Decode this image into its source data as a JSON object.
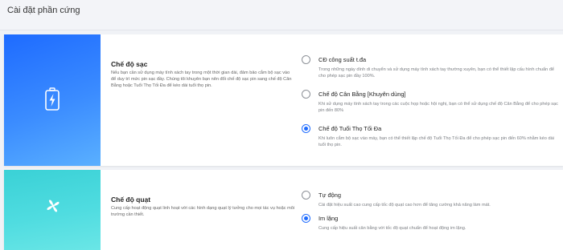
{
  "header": {
    "title": "Cài đặt phần cứng"
  },
  "charge": {
    "icon": "battery-charging-icon",
    "title": "Chế độ sạc",
    "description": "Nếu bạn cần sử dụng máy tính xách tay trong một thời gian dài, đảm bảo cắm bộ sạc vào để duy trì mức pin sạc đầy. Chúng tôi khuyên bạn nên đổi chế độ sạc pin sang chế độ Cân Bằng hoặc Tuổi Thọ Tối Đa để kéo dài tuổi thọ pin.",
    "options": [
      {
        "label": "CĐ công suất t.đa",
        "desc": "Trong những ngày dính di chuyển và sử dụng máy tính xách tay thường xuyên, bạn có thể thiết lập cấu hình chuẩn để cho phép sạc pin đầy 100%.",
        "selected": false
      },
      {
        "label": "Chế độ Cân Bằng [Khuyên dùng]",
        "desc": "Khi sử dụng máy tính xách tay trong các cuộc họp hoặc hội nghị, bạn có thể sử dụng chế độ Cân Bằng để cho phép sạc pin đến 80%",
        "selected": false
      },
      {
        "label": "Chế độ Tuổi Thọ Tối Đa",
        "desc": "Khi luôn cắm bộ sạc vào máy, bạn có thể thiết lập chế độ Tuổi Thọ Tối Đa để cho phép sạc pin đến 60% nhằm kéo dài tuổi thọ pin.",
        "selected": true
      }
    ]
  },
  "fan": {
    "icon": "fan-icon",
    "title": "Chế độ quạt",
    "description": "Cung cấp hoạt động quạt linh hoạt với các hình dạng quạt lý tưởng cho mọi tác vụ hoặc môi trường cần thiết.",
    "options": [
      {
        "label": "Tự động",
        "desc": "Cài đặt hiệu suất cao cung cấp tốc độ quạt cao hơn để tăng cường khả năng làm mát.",
        "selected": false
      },
      {
        "label": "Im lặng",
        "desc": "Cung cấp hiệu suất cân bằng với tốc độ quạt chuẩn để hoạt động im lặng.",
        "selected": true
      }
    ]
  },
  "colors": {
    "accent": "#1e6bff",
    "charge_panel": "#2f7dff",
    "fan_panel": "#4fdce0"
  }
}
